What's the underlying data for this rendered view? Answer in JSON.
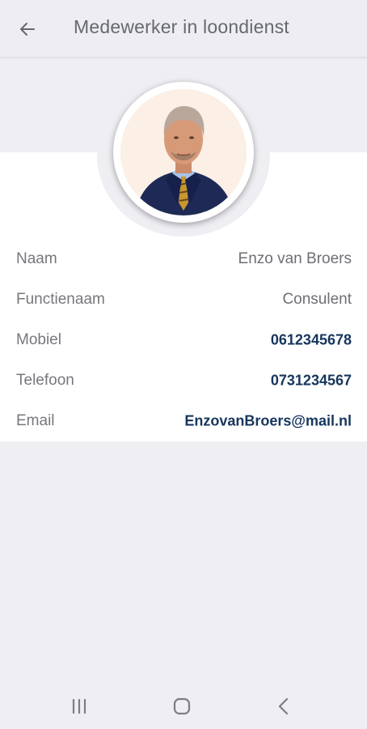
{
  "appbar": {
    "title": "Medewerker in loondienst",
    "back_icon": "arrow-left-icon"
  },
  "profile": {
    "fields": [
      {
        "label": "Naam",
        "value": "Enzo van Broers",
        "link": false
      },
      {
        "label": "Functienaam",
        "value": "Consulent",
        "link": false
      },
      {
        "label": "Mobiel",
        "value": "0612345678",
        "link": true
      },
      {
        "label": "Telefoon",
        "value": "0731234567",
        "link": true
      },
      {
        "label": "Email",
        "value": "EnzovanBroers@mail.nl",
        "link": true
      }
    ]
  },
  "colors": {
    "accent": "#16365d",
    "background": "#eeeef3",
    "card": "#ffffff"
  },
  "navbar": {
    "icons": [
      "recent-apps-icon",
      "home-icon",
      "back-nav-icon"
    ]
  }
}
